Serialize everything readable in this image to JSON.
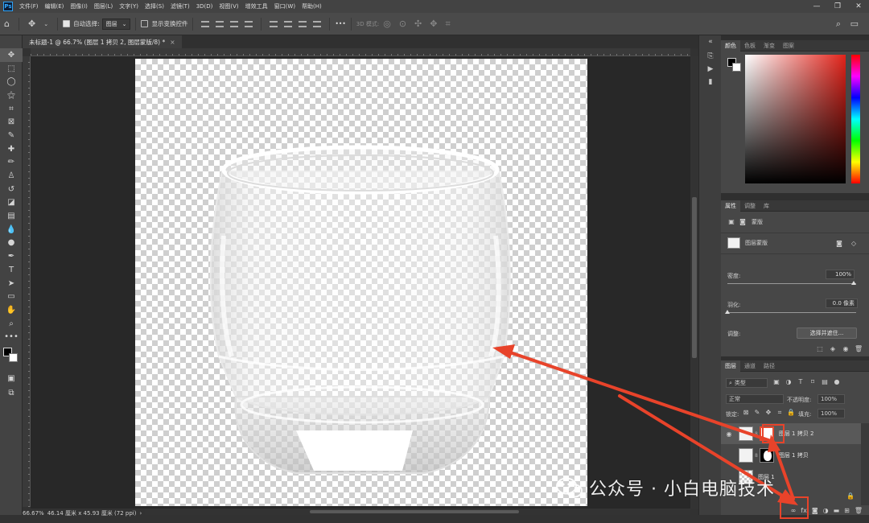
{
  "app": {
    "logo": "Ps"
  },
  "menu": [
    "文件(F)",
    "编辑(E)",
    "图像(I)",
    "图层(L)",
    "文字(Y)",
    "选择(S)",
    "滤镜(T)",
    "3D(D)",
    "视图(V)",
    "增效工具",
    "窗口(W)",
    "帮助(H)"
  ],
  "window_controls": {
    "minimize": "—",
    "restore": "❐",
    "close": "✕"
  },
  "options": {
    "auto_select_label": "自动选择:",
    "auto_select_target": "图层",
    "show_transform_label": "显示变换控件",
    "mode_3d": "3D 模式:",
    "more": "•••"
  },
  "document": {
    "tab_title": "未标题-1 @ 66.7% (图层 1 拷贝 2, 图层蒙版/8) *",
    "close": "×"
  },
  "status": {
    "zoom": "66.67%",
    "doc_size": "46.14 厘米 x 45.93 厘米 (72 ppi)",
    "arrow": "›"
  },
  "panels": {
    "color_tabs": [
      "颜色",
      "色板",
      "渐变",
      "图案"
    ],
    "properties_tabs": [
      "属性",
      "调整",
      "库"
    ],
    "properties": {
      "mask_label": "蒙版",
      "layer_mask_label": "图层蒙版",
      "density_label": "密度:",
      "density_value": "100%",
      "feather_label": "羽化:",
      "feather_value": "0.0 像素",
      "adjust_label": "调整:",
      "select_and_mask": "选择并遮住..."
    },
    "layers_tabs": [
      "图层",
      "通道",
      "路径"
    ],
    "layers": {
      "filter_kind": "类型",
      "blend_mode": "正常",
      "opacity_label": "不透明度:",
      "opacity_value": "100%",
      "lock_label": "锁定:",
      "fill_label": "填充:",
      "fill_value": "100%",
      "items": [
        {
          "name": "图层 1 拷贝 2",
          "visible": true,
          "selected": true
        },
        {
          "name": "图层 1 拷贝",
          "visible": false,
          "selected": false
        },
        {
          "name": "图层 1",
          "visible": false,
          "selected": false
        }
      ]
    }
  },
  "watermark": {
    "text": "公众号 · 小白电脑技术"
  },
  "colors": {
    "annotation_red": "#e8432a",
    "brand_blue": "#31a8ff"
  }
}
